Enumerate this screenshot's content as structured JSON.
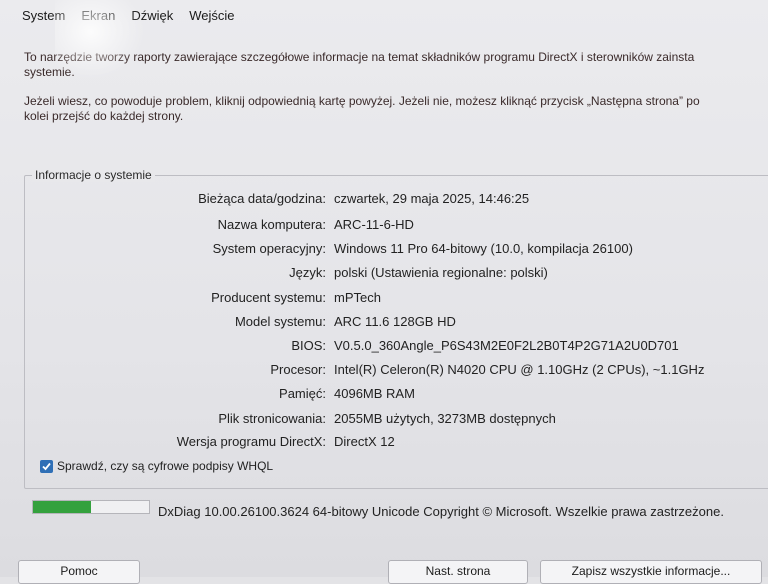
{
  "tabs": [
    "System",
    "Ekran",
    "Dźwięk",
    "Wejście"
  ],
  "intro": {
    "line1": "To narzędzie tworzy raporty zawierające szczegółowe informacje na temat składników programu DirectX i sterowników zainsta",
    "line1b": "systemie.",
    "line2": "Jeżeli wiesz, co powoduje problem, kliknij odpowiednią kartę powyżej. Jeżeli nie, możesz kliknąć przycisk „Następna strona” po",
    "line2b": "kolei przejść do każdej strony."
  },
  "group": {
    "title": "Informacje o systemie"
  },
  "system_info": [
    {
      "label": "Bieżąca data/godzina:",
      "value": "czwartek, 29 maja 2025, 14:46:25"
    },
    {
      "label": "Nazwa komputera:",
      "value": "ARC-11-6-HD"
    },
    {
      "label": "System operacyjny:",
      "value": "Windows 11 Pro 64-bitowy (10.0, kompilacja 26100)"
    },
    {
      "label": "Język:",
      "value": "polski (Ustawienia regionalne: polski)"
    },
    {
      "label": "Producent systemu:",
      "value": "mPTech"
    },
    {
      "label": "Model systemu:",
      "value": "ARC 11.6 128GB HD"
    },
    {
      "label": "BIOS:",
      "value": "V0.5.0_360Angle_P6S43M2E0F2L2B0T4P2G71A2U0D701"
    },
    {
      "label": "Procesor:",
      "value": "Intel(R) Celeron(R) N4020 CPU @ 1.10GHz (2 CPUs), ~1.1GHz"
    },
    {
      "label": "Pamięć:",
      "value": "4096MB RAM"
    },
    {
      "label": "Plik stronicowania:",
      "value": "2055MB użytych, 3273MB dostępnych"
    },
    {
      "label": "Wersja programu DirectX:",
      "value": "DirectX 12"
    }
  ],
  "checkbox": {
    "label": "Sprawdź, czy są cyfrowe podpisy WHQL",
    "checked": true
  },
  "status": {
    "progress": 0.5,
    "text": "DxDiag 10.00.26100.3624 64-bitowy Unicode  Copyright © Microsoft. Wszelkie prawa zastrzeżone."
  },
  "buttons": {
    "help": "Pomoc",
    "next": "Nast. strona",
    "save": "Zapisz wszystkie informacje..."
  },
  "colors": {
    "progress_fill": "#34a13d",
    "checkbox": "#2f6fb6"
  }
}
